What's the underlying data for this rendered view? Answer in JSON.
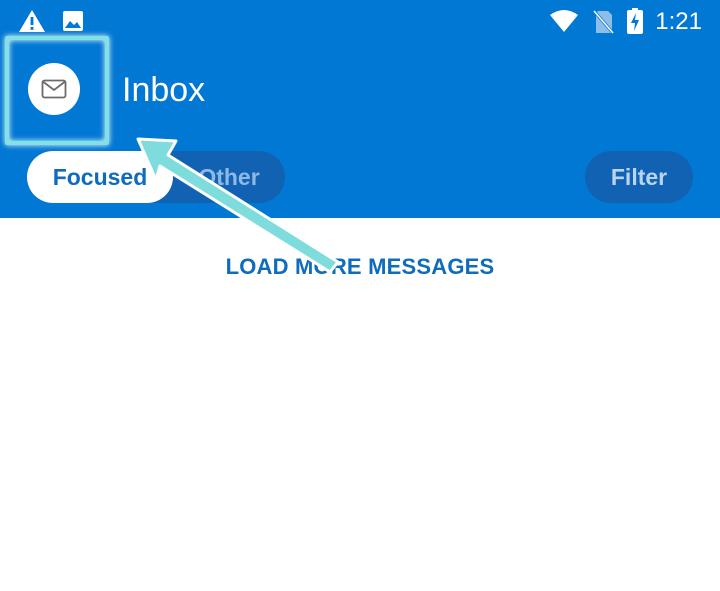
{
  "status_bar": {
    "time": "1:21",
    "icons": [
      "warning-icon",
      "image-icon",
      "wifi-icon",
      "no-sim-icon",
      "battery-charging-icon"
    ]
  },
  "header": {
    "title": "Inbox",
    "avatar_icon": "mail-icon"
  },
  "tabs": [
    {
      "label": "Focused",
      "selected": true
    },
    {
      "label": "Other",
      "selected": false
    }
  ],
  "filter_label": "Filter",
  "load_more_label": "LOAD MORE MESSAGES",
  "colors": {
    "app_bar": "#0078d4",
    "tab_track": "#1262b3",
    "accent_text": "#0f6cbd",
    "highlight": "#7fe3e6"
  }
}
